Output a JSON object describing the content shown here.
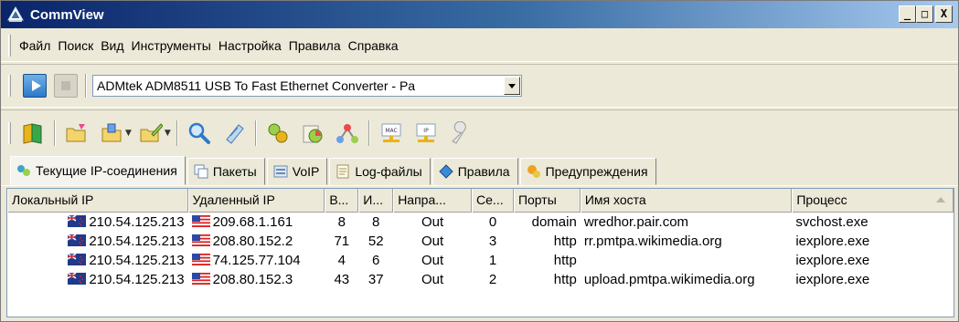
{
  "window": {
    "title": "CommView",
    "min_label": "_",
    "max_label": "□",
    "close_label": "X"
  },
  "menu": [
    "Файл",
    "Поиск",
    "Вид",
    "Инструменты",
    "Настройка",
    "Правила",
    "Справка"
  ],
  "device": {
    "adapter": "ADMtek ADM8511 USB To Fast Ethernet Converter - Pa"
  },
  "toolbar_icons": [
    "book-icon",
    "open-folder-icon",
    "save-folder-icon",
    "edit-folder-icon",
    "search-icon",
    "notepad-icon",
    "connections-icon",
    "statistics-icon",
    "nodes-icon",
    "mac-address-icon",
    "ip-address-icon",
    "wrench-icon"
  ],
  "tabs": [
    {
      "label": "Текущие IP-соединения",
      "icon": "connections-tab-icon"
    },
    {
      "label": "Пакеты",
      "icon": "packets-tab-icon"
    },
    {
      "label": "VoIP",
      "icon": "voip-tab-icon"
    },
    {
      "label": "Log-файлы",
      "icon": "logfiles-tab-icon"
    },
    {
      "label": "Правила",
      "icon": "rules-tab-icon"
    },
    {
      "label": "Предупреждения",
      "icon": "alerts-tab-icon"
    }
  ],
  "grid": {
    "columns": [
      "Локальный IP",
      "Удаленный IP",
      "В...",
      "И...",
      "Напра...",
      "Се...",
      "Порты",
      "Имя хоста",
      "Процесс"
    ],
    "sorted_column": 8,
    "rows": [
      {
        "local_ip": "210.54.125.213",
        "remote_ip": "209.68.1.161",
        "in": "8",
        "out": "8",
        "direction": "Out",
        "sessions": "0",
        "port": "domain",
        "host": "wredhor.pair.com",
        "process": "svchost.exe"
      },
      {
        "local_ip": "210.54.125.213",
        "remote_ip": "208.80.152.2",
        "in": "71",
        "out": "52",
        "direction": "Out",
        "sessions": "3",
        "port": "http",
        "host": "rr.pmtpa.wikimedia.org",
        "process": "iexplore.exe"
      },
      {
        "local_ip": "210.54.125.213",
        "remote_ip": "74.125.77.104",
        "in": "4",
        "out": "6",
        "direction": "Out",
        "sessions": "1",
        "port": "http",
        "host": "",
        "process": "iexplore.exe"
      },
      {
        "local_ip": "210.54.125.213",
        "remote_ip": "208.80.152.3",
        "in": "43",
        "out": "37",
        "direction": "Out",
        "sessions": "2",
        "port": "http",
        "host": "upload.pmtpa.wikimedia.org",
        "process": "iexplore.exe"
      }
    ]
  },
  "colors": {
    "title_start": "#0a246a",
    "title_end": "#a6caf0",
    "chrome": "#ece9d8",
    "play_button": "#2d79c9"
  }
}
